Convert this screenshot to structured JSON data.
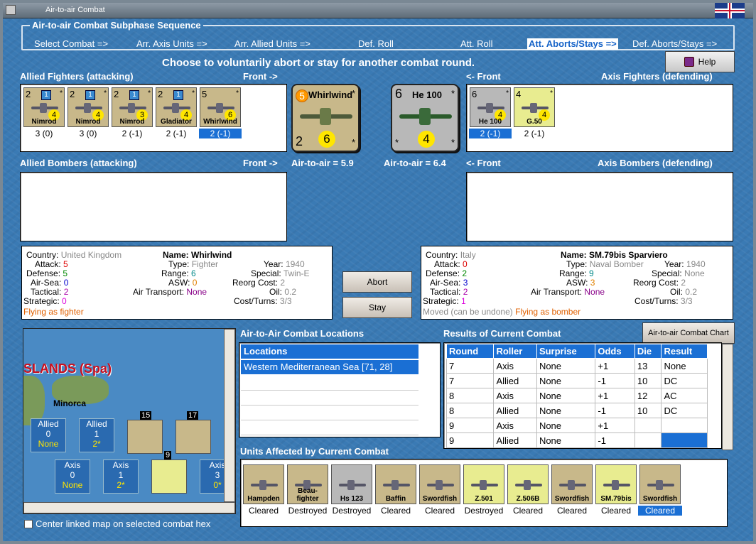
{
  "window": {
    "title": "Air-to-air Combat"
  },
  "sequence": {
    "title": "Air-to-air Combat Subphase Sequence",
    "steps": [
      "Select Combat =>",
      "Arr. Axis Units =>",
      "Arr. Allied Units =>",
      "Def. Roll",
      "Att. Roll",
      "Att. Aborts/Stays =>",
      "Def. Aborts/Stays =>"
    ],
    "active": "Att. Aborts/Stays =>"
  },
  "instruction": "Choose to voluntarily abort or stay for another combat round.",
  "help_label": "Help",
  "labels": {
    "allied_fighters": "Allied Fighters (attacking)",
    "front_right": "Front ->",
    "front_left": "<- Front",
    "axis_fighters": "Axis Fighters (defending)",
    "allied_bombers": "Allied Bombers (attacking)",
    "axis_bombers": "Axis Bombers (defending)",
    "a2a_allied": "Air-to-air = 5.9",
    "a2a_axis": "Air-to-air = 6.4"
  },
  "allied_fighters": [
    {
      "att": "2",
      "badge": "1",
      "move": "4",
      "name": "Nimrod",
      "value": "3 (0)",
      "color": "#c8b88a"
    },
    {
      "att": "2",
      "badge": "1",
      "move": "4",
      "name": "Nimrod",
      "value": "3 (0)",
      "color": "#c8b88a"
    },
    {
      "att": "2",
      "badge": "1",
      "move": "3",
      "name": "Nimrod",
      "value": "2 (-1)",
      "color": "#c8b88a"
    },
    {
      "att": "2",
      "badge": "1",
      "move": "4",
      "name": "Gladiator",
      "value": "2 (-1)",
      "color": "#c8b88a"
    },
    {
      "att": "5",
      "badge": "",
      "move": "6",
      "name": "Whirlwind",
      "value": "2 (-1)",
      "color": "#c8b88a"
    }
  ],
  "axis_fighters": [
    {
      "att": "6",
      "name": "He 100",
      "move": "4",
      "value": "2 (-1)",
      "color": "#b8b8b8"
    },
    {
      "att": "4",
      "name": "G.50",
      "move": "4",
      "value": "2 (-1)",
      "color": "#e8ec90"
    }
  ],
  "big_allied": {
    "att": "5",
    "name": "Whirlwind",
    "def": "2",
    "move": "6"
  },
  "big_axis": {
    "att": "6",
    "name": "He 100",
    "def": "",
    "move": "4"
  },
  "allied_info": {
    "country_k": "Country:",
    "country": "United Kingdom",
    "attack_k": "Attack:",
    "attack": "5",
    "defense_k": "Defense:",
    "defense": "5",
    "airsea_k": "Air-Sea:",
    "airsea": "0",
    "tactical_k": "Tactical:",
    "tactical": "2",
    "strategic_k": "Strategic:",
    "strategic": "0",
    "flying": "Flying as fighter",
    "name_k": "Name:",
    "name": "Whirlwind",
    "type_k": "Type:",
    "type": "Fighter",
    "range_k": "Range:",
    "range": "6",
    "asw_k": "ASW:",
    "asw": "0",
    "airtrans_k": "Air Transport:",
    "airtrans": "None",
    "year_k": "Year:",
    "year": "1940",
    "special_k": "Special:",
    "special": "Twin-E",
    "reorg_k": "Reorg Cost:",
    "reorg": "2",
    "oil_k": "Oil:",
    "oil": "0.2",
    "cost_k": "Cost/Turns:",
    "cost": "3/3"
  },
  "axis_info": {
    "country_k": "Country:",
    "country": "Italy",
    "attack_k": "Attack:",
    "attack": "0",
    "defense_k": "Defense:",
    "defense": "2",
    "airsea_k": "Air-Sea:",
    "airsea": "3",
    "tactical_k": "Tactical:",
    "tactical": "2",
    "strategic_k": "Strategic:",
    "strategic": "1",
    "moved": "Moved (can be undone)",
    "flying": "Flying as bomber",
    "name_k": "Name:",
    "name": "SM.79bis Sparviero",
    "type_k": "Type:",
    "type": "Naval Bomber",
    "range_k": "Range:",
    "range": "9",
    "asw_k": "ASW:",
    "asw": "3",
    "airtrans_k": "Air Transport:",
    "airtrans": "None",
    "year_k": "Year:",
    "year": "1940",
    "special_k": "Special:",
    "special": "None",
    "reorg_k": "Reorg Cost:",
    "reorg": "2",
    "oil_k": "Oil:",
    "oil": "0.2",
    "cost_k": "Cost/Turns:",
    "cost": "3/3"
  },
  "buttons": {
    "abort": "Abort",
    "stay": "Stay",
    "chart": "Air-to-air Combat Chart"
  },
  "map": {
    "region": "SLANDS (Spa)",
    "hex_name": "Minorca",
    "stack1": "15",
    "stack2": "17",
    "stack3": "9",
    "boxes": [
      {
        "side": "Allied",
        "count": "0",
        "extra": "None"
      },
      {
        "side": "Allied",
        "count": "1",
        "extra": "2*"
      },
      {
        "side": "Axis",
        "count": "0",
        "extra": "None"
      },
      {
        "side": "Axis",
        "count": "1",
        "extra": "2*"
      },
      {
        "side": "Axis",
        "count": "3",
        "extra": "0*"
      }
    ],
    "center_label": "Center linked map on selected combat hex"
  },
  "locations": {
    "title": "Air-to-Air Combat Locations",
    "header": "Locations",
    "items": [
      "Western Mediterranean Sea [71, 28]"
    ]
  },
  "results": {
    "title": "Results of Current Combat",
    "headers": [
      "Round",
      "Roller",
      "Surprise",
      "Odds",
      "Die",
      "Result"
    ],
    "rows": [
      [
        "7",
        "Axis",
        "None",
        "+1",
        "13",
        "None"
      ],
      [
        "7",
        "Allied",
        "None",
        "-1",
        "10",
        "DC"
      ],
      [
        "8",
        "Axis",
        "None",
        "+1",
        "12",
        "AC"
      ],
      [
        "8",
        "Allied",
        "None",
        "-1",
        "10",
        "DC"
      ],
      [
        "9",
        "Axis",
        "None",
        "+1",
        "",
        ""
      ],
      [
        "9",
        "Allied",
        "None",
        "-1",
        "",
        ""
      ]
    ]
  },
  "affected": {
    "title": "Units Affected by Current Combat",
    "units": [
      {
        "name": "Hampden",
        "status": "Cleared",
        "color": "#c8b88a"
      },
      {
        "name": "Beau-fighter",
        "status": "Destroyed",
        "color": "#c8b88a"
      },
      {
        "name": "Hs 123",
        "status": "Destroyed",
        "color": "#b8b8b8"
      },
      {
        "name": "Baffin",
        "status": "Cleared",
        "color": "#c8b88a"
      },
      {
        "name": "Swordfish",
        "status": "Cleared",
        "color": "#c8b88a"
      },
      {
        "name": "Z.501",
        "status": "Destroyed",
        "color": "#e8ec90"
      },
      {
        "name": "Z.506B",
        "status": "Cleared",
        "color": "#e8ec90"
      },
      {
        "name": "Swordfish",
        "status": "Cleared",
        "color": "#c8b88a"
      },
      {
        "name": "SM.79bis",
        "status": "Cleared",
        "color": "#e8ec90"
      },
      {
        "name": "Swordfish",
        "status": "Cleared",
        "color": "#c8b88a"
      }
    ]
  }
}
